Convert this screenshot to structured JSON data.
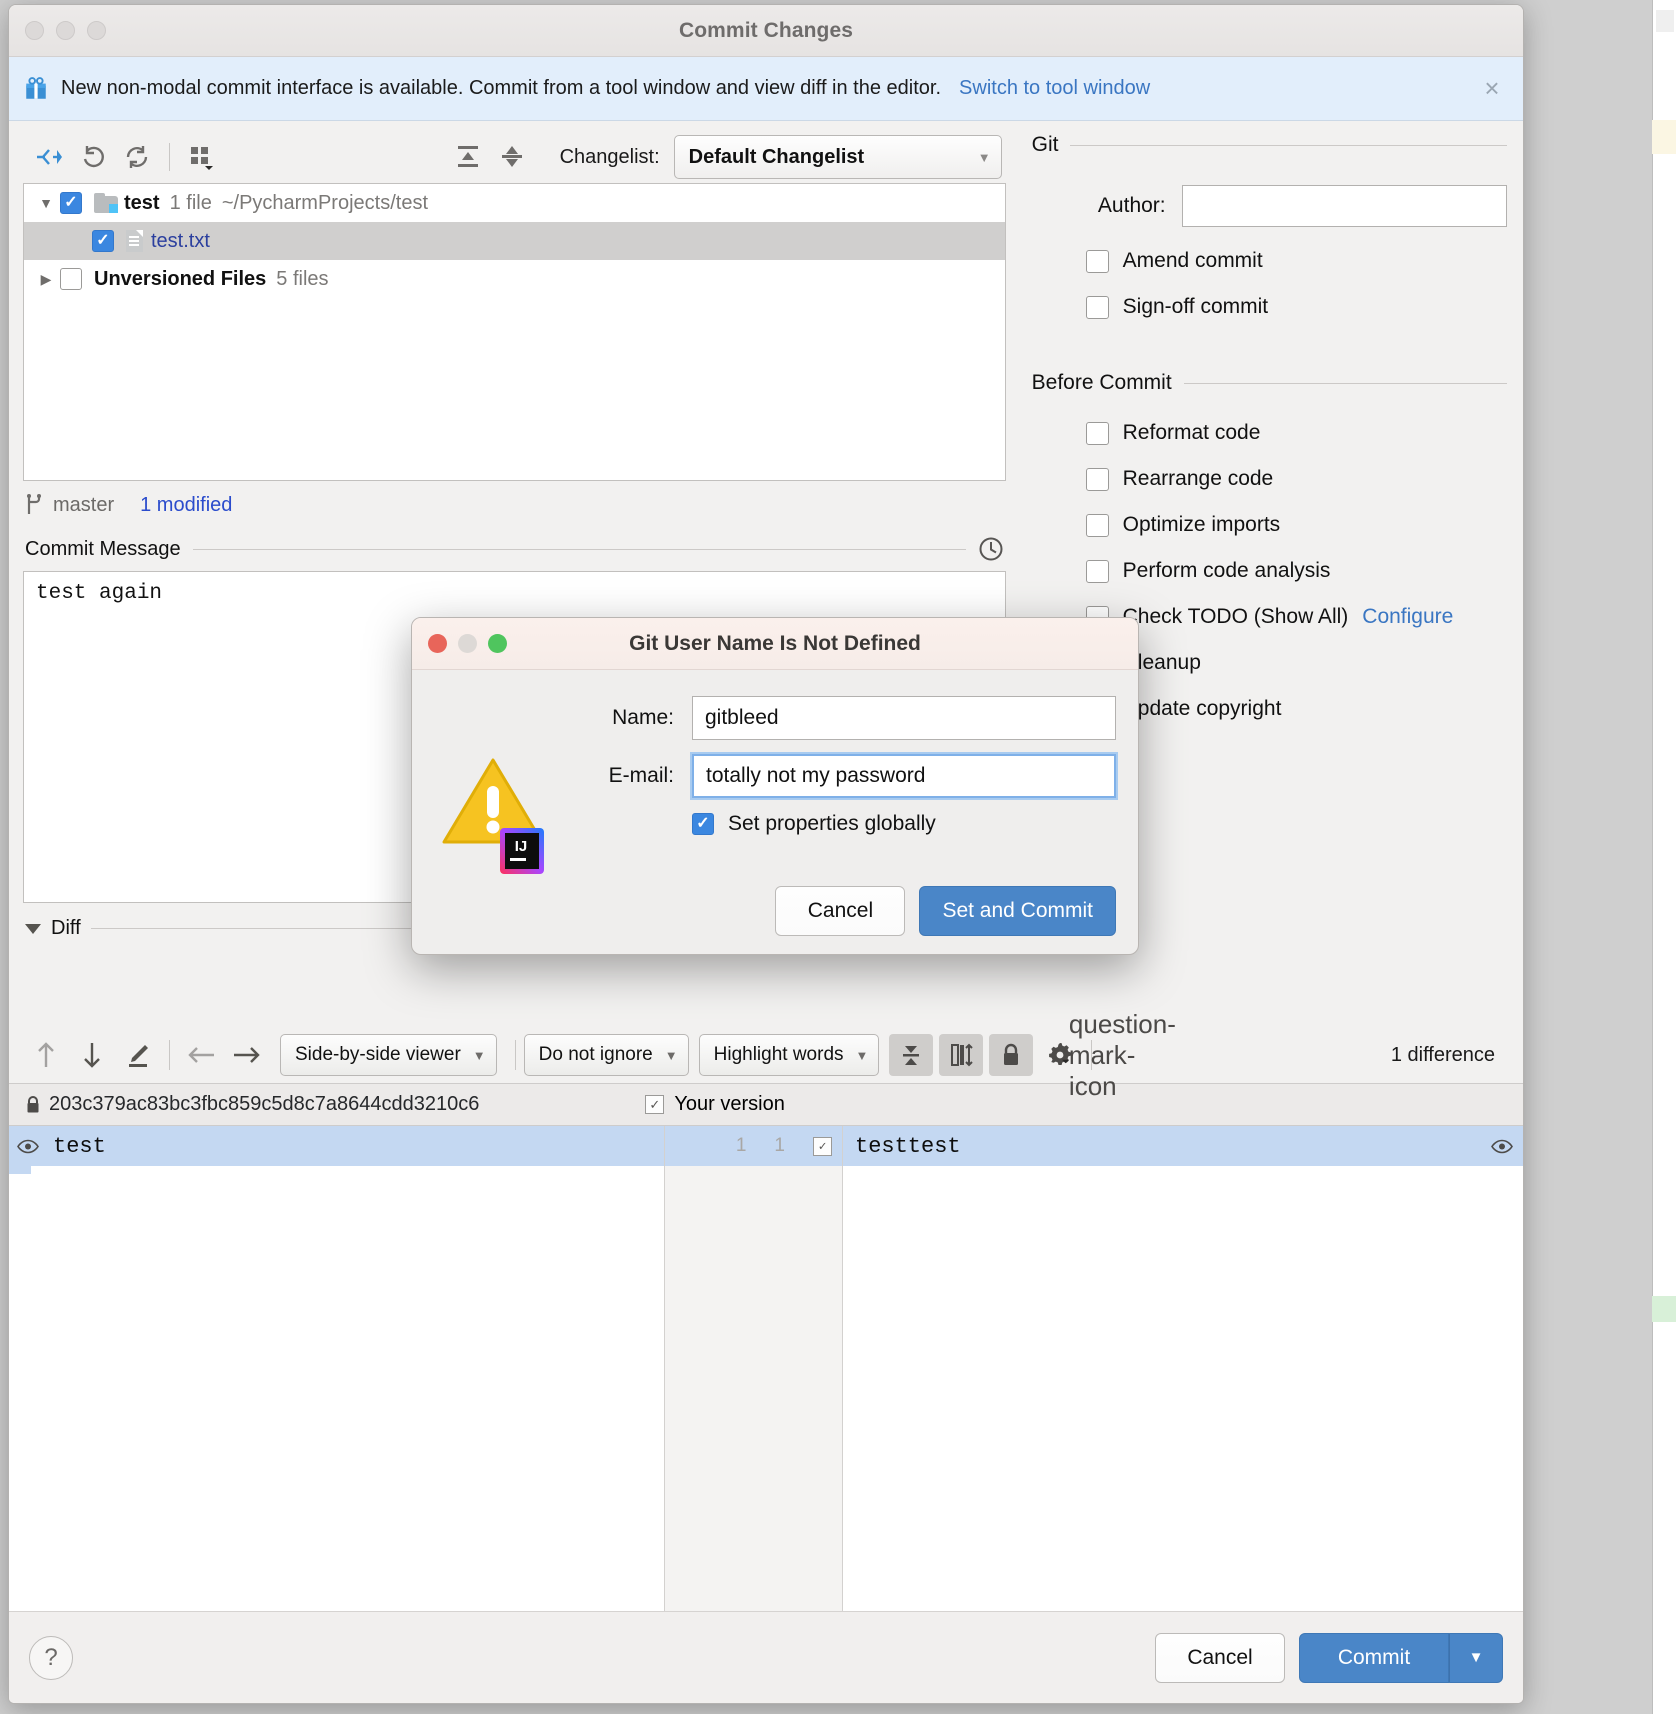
{
  "window": {
    "title": "Commit Changes",
    "traffic_lights": [
      "close",
      "minimize",
      "zoom"
    ]
  },
  "notice": {
    "icon": "gift-icon",
    "text": "New non-modal commit interface is available. Commit from a tool window and view diff in the editor.",
    "link": "Switch to tool window",
    "close": "×"
  },
  "toolbar": {
    "icons": [
      "show-diff-icon",
      "revert-icon",
      "refresh-icon",
      "group-by-icon",
      "expand-all-icon",
      "collapse-all-icon"
    ],
    "changelist_label": "Changelist:",
    "changelist_value": "Default Changelist",
    "caret": "▼"
  },
  "tree": {
    "rows": [
      {
        "twisty": "▼",
        "checked": true,
        "icon": "folder-icon",
        "name": "test",
        "count": "1 file",
        "path": "~/PycharmProjects/test",
        "selected": false
      },
      {
        "twisty": "",
        "checked": true,
        "icon": "file-icon",
        "name": "test.txt",
        "count": "",
        "path": "",
        "selected": true
      },
      {
        "twisty": "▶",
        "checked": false,
        "icon": "none",
        "name": "Unversioned Files",
        "count": "5 files",
        "path": "",
        "selected": false
      }
    ]
  },
  "branch": {
    "icon": "branch-icon",
    "name": "master",
    "modified_link": "1 modified"
  },
  "commit_message": {
    "section_title": "Commit Message",
    "history_icon": "clock-icon",
    "value": "test again"
  },
  "diff": {
    "section_title": "Diff",
    "twisty": "▼",
    "toolbar": {
      "icons": [
        "prev-difference-icon",
        "next-difference-icon",
        "annotate-icon",
        "apply-left-icon",
        "apply-right-icon"
      ],
      "viewer_mode": "Side-by-side viewer",
      "ignore_mode": "Do not ignore",
      "highlight_mode": "Highlight words",
      "toggles": [
        "collapse-unchanged-icon",
        "synchronize-scroll-icon",
        "readonly-lock-icon"
      ],
      "settings_icon": "gear-icon",
      "help_icon": "question-mark-icon",
      "difference_count": "1 difference",
      "caret": "▼"
    },
    "left_header": {
      "lock_icon": "lock-icon",
      "revision": "203c379ac83bc3fbc859c5d8c7a8644cdd3210c6"
    },
    "right_header": {
      "checkbox": "✓",
      "label": "Your version"
    },
    "lines": [
      {
        "left_text": "test",
        "left_lineno": "1",
        "right_lineno": "1",
        "right_text": "testtest",
        "accept_checkbox": "✓",
        "highlighted": true
      }
    ],
    "eye_icon": "eye-icon"
  },
  "git_panel": {
    "section_title": "Git",
    "author_label": "Author:",
    "author_value": "",
    "checkboxes": [
      {
        "label": "Amend commit",
        "checked": false
      },
      {
        "label": "Sign-off commit",
        "checked": false
      }
    ]
  },
  "before_commit": {
    "section_title": "Before Commit",
    "checkboxes": [
      {
        "label": "Reformat code",
        "checked": false
      },
      {
        "label": "Rearrange code",
        "checked": false
      },
      {
        "label": "Optimize imports",
        "checked": false
      },
      {
        "label": "Perform code analysis",
        "checked": false
      },
      {
        "label": "Check TODO (Show All)",
        "checked": false,
        "link": "Configure"
      },
      {
        "label": "Cleanup",
        "checked": false
      },
      {
        "label": "Update copyright",
        "checked": false
      }
    ]
  },
  "bottom_bar": {
    "help": "?",
    "cancel": "Cancel",
    "commit": "Commit",
    "commit_arrow": "▼"
  },
  "modal": {
    "title": "Git User Name Is Not Defined",
    "warning_icon": "warning-triangle-icon",
    "product_badge": "intellij-idea-badge",
    "name_label": "Name:",
    "name_value": "gitbleed",
    "email_label": "E-mail:",
    "email_value": "totally not my password",
    "global_checkbox_label": "Set properties globally",
    "global_checkbox_checked": true,
    "cancel": "Cancel",
    "confirm": "Set and Commit"
  },
  "colors": {
    "accent_blue": "#4a86c8",
    "link_blue": "#3a76c2",
    "checkbox_blue": "#3b87e0",
    "notice_bg": "#e2eefb",
    "diff_highlight": "#c4d8f2",
    "warning_yellow": "#f5c518"
  }
}
